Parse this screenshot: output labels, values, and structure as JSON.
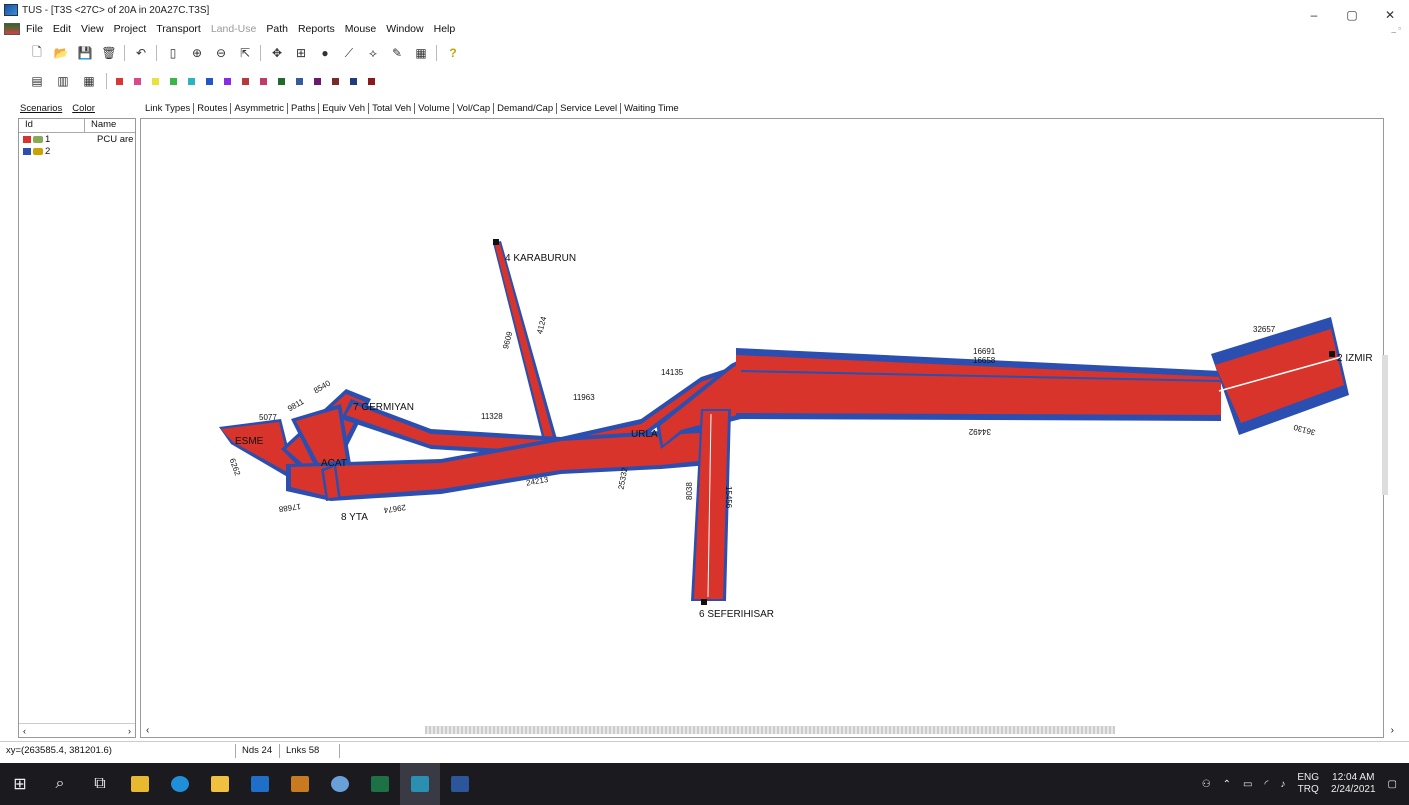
{
  "window": {
    "title": "TUS - [T3S <27C> of 20A in 20A27C.T3S]"
  },
  "window_controls": {
    "minimize": "–",
    "maximize": "▢",
    "close": "✕"
  },
  "menu": [
    "File",
    "Edit",
    "View",
    "Project",
    "Transport",
    "Land-Use",
    "Path",
    "Reports",
    "Mouse",
    "Window",
    "Help"
  ],
  "menu_disabled": [
    "Land-Use"
  ],
  "toolbar_colors": [
    "#d93636",
    "#d94a8a",
    "#e8e23a",
    "#39b54a",
    "#2bb3c0",
    "#2356c8",
    "#8a2be2",
    "#b33b3b",
    "#c23a6a",
    "#1f6b2e",
    "#355c9a",
    "#6a1a6a",
    "#7a2a2a",
    "#1f3d7a",
    "#8a1a1a"
  ],
  "left_panel": {
    "tabs": [
      "Scenarios",
      "Color"
    ],
    "headers": [
      "Id",
      "Name"
    ],
    "rows": [
      {
        "id": "1",
        "name": "PCU are",
        "color": "#d9342b"
      },
      {
        "id": "2",
        "name": "",
        "color": "#2b4fb0"
      }
    ]
  },
  "main_tabs": [
    "Link Types",
    "Routes",
    "Asymmetric",
    "Paths",
    "Equiv Veh",
    "Total Veh",
    "Volume",
    "Vol/Cap",
    "Demand/Cap",
    "Service Level",
    "Waiting Time"
  ],
  "map": {
    "nodes": {
      "karaburun": "4 KARABURUN",
      "izmir": "2 IZMIR",
      "germiyan": "7 GERMIYAN",
      "seferihisar": "6 SEFERIHISAR",
      "yta": "8 YTA",
      "cesme": "ESME",
      "alacati": "ACAT",
      "urla": "URLA"
    },
    "links": {
      "l16691": "16691",
      "l16658": "16658",
      "l32657": "32657",
      "l34492": "34492",
      "l36130": "36130",
      "l14135": "14135",
      "l11963": "11963",
      "l11328": "11328",
      "l9609": "9609",
      "l4124": "4124",
      "l8540": "8540",
      "l9811": "9811",
      "l5077": "5077",
      "l24213": "24213",
      "l25332": "25332",
      "l29674": "29674",
      "l17688": "17688",
      "l8038": "8038",
      "l15456": "15456",
      "l6262": "6262"
    }
  },
  "status": {
    "xy": "xy=(263585.4, 381201.6)",
    "nds": "Nds 24",
    "lnks": "Lnks 58"
  },
  "taskbar": {
    "lang_top": "ENG",
    "lang_bottom": "TRQ",
    "time": "12:04 AM",
    "date": "2/24/2021"
  }
}
